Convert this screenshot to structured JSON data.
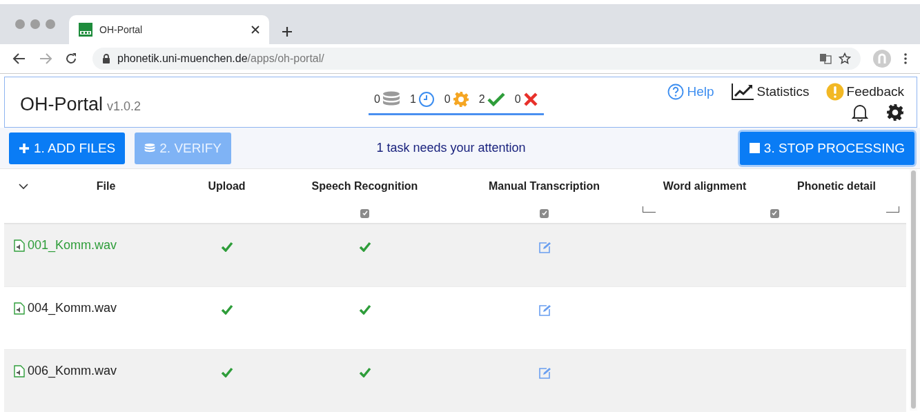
{
  "browser": {
    "tab_title": "OH-Portal",
    "url_host": "phonetik.uni-muenchen.de",
    "url_path": "/apps/oh-portal/"
  },
  "app": {
    "title": "OH-Portal",
    "version": "v1.0.2"
  },
  "status_counts": [
    {
      "kind": "queued",
      "count": "0"
    },
    {
      "kind": "waiting",
      "count": "1"
    },
    {
      "kind": "processing",
      "count": "0"
    },
    {
      "kind": "done",
      "count": "2"
    },
    {
      "kind": "failed",
      "count": "0"
    }
  ],
  "header_links": [
    {
      "kind": "help",
      "label": "Help"
    },
    {
      "kind": "statistics",
      "label": "Statistics"
    },
    {
      "kind": "feedback",
      "label": "Feedback"
    }
  ],
  "actions": [
    {
      "kind": "add",
      "label": "1. ADD FILES",
      "disabled": false
    },
    {
      "kind": "verify",
      "label": "2. VERIFY",
      "disabled": true
    }
  ],
  "attention": "1 task needs your attention",
  "stop_button": {
    "label": "3. STOP PROCESSING"
  },
  "table": {
    "columns": [
      {
        "label": "File"
      },
      {
        "label": "Upload"
      },
      {
        "label": "Speech Recognition",
        "checked": true
      },
      {
        "label": "Manual Transcription",
        "checked": true
      },
      {
        "label": "Word alignment"
      },
      {
        "label": "Phonetic detail"
      }
    ],
    "group_checkbox": {
      "checked": true
    },
    "rows": [
      {
        "file": "001_Komm.wav",
        "selected": true,
        "cells": [
          {
            "kind": "done"
          },
          {
            "kind": "done"
          },
          {
            "kind": "edit"
          }
        ]
      },
      {
        "file": "004_Komm.wav",
        "selected": false,
        "cells": [
          {
            "kind": "done"
          },
          {
            "kind": "done"
          },
          {
            "kind": "edit"
          }
        ]
      },
      {
        "file": "006_Komm.wav",
        "selected": false,
        "cells": [
          {
            "kind": "done"
          },
          {
            "kind": "done"
          },
          {
            "kind": "edit"
          }
        ]
      }
    ]
  }
}
